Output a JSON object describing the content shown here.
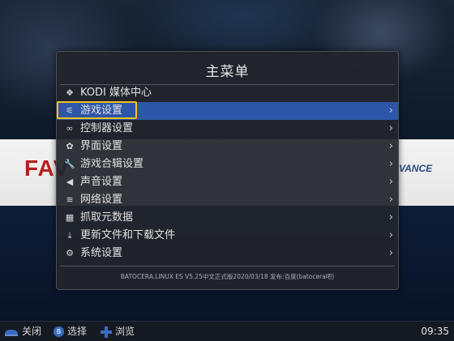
{
  "menu": {
    "title": "主菜单",
    "items": [
      {
        "icon": "kodi-icon",
        "glyph": "❖",
        "label": "KODI 媒体中心",
        "has_arrow": false,
        "selected": false
      },
      {
        "icon": "sliders-icon",
        "glyph": "⚟",
        "label": "游戏设置",
        "has_arrow": true,
        "selected": true
      },
      {
        "icon": "gamepad-icon",
        "glyph": "∞",
        "label": "控制器设置",
        "has_arrow": true,
        "selected": false
      },
      {
        "icon": "palette-icon",
        "glyph": "✿",
        "label": "界面设置",
        "has_arrow": true,
        "selected": false
      },
      {
        "icon": "wrench-icon",
        "glyph": "🔧",
        "label": "游戏合辑设置",
        "has_arrow": true,
        "selected": false
      },
      {
        "icon": "speaker-icon",
        "glyph": "◀",
        "label": "声音设置",
        "has_arrow": true,
        "selected": false
      },
      {
        "icon": "wifi-icon",
        "glyph": "≋",
        "label": "网络设置",
        "has_arrow": true,
        "selected": false
      },
      {
        "icon": "scraper-icon",
        "glyph": "▦",
        "label": "抓取元数据",
        "has_arrow": true,
        "selected": false
      },
      {
        "icon": "download-icon",
        "glyph": "⤓",
        "label": "更新文件和下载文件",
        "has_arrow": true,
        "selected": false
      },
      {
        "icon": "gears-icon",
        "glyph": "⚙",
        "label": "系统设置",
        "has_arrow": true,
        "selected": false
      }
    ],
    "chevron": "›",
    "footer": "BATOCERA.LINUX ES V5.25中文正式版2020/03/18  发布:百度(batocera吧)"
  },
  "helpbar": {
    "close_label": "关闭",
    "select_button": "B",
    "select_label": "选择",
    "browse_label": "浏览",
    "clock": "09:35"
  },
  "background": {
    "left_logo_text": "FAV",
    "right_logo_text": "VANCE"
  },
  "colors": {
    "selection": "#2e56a8",
    "focus_border": "#f2c21a",
    "panel": "#22252c"
  }
}
